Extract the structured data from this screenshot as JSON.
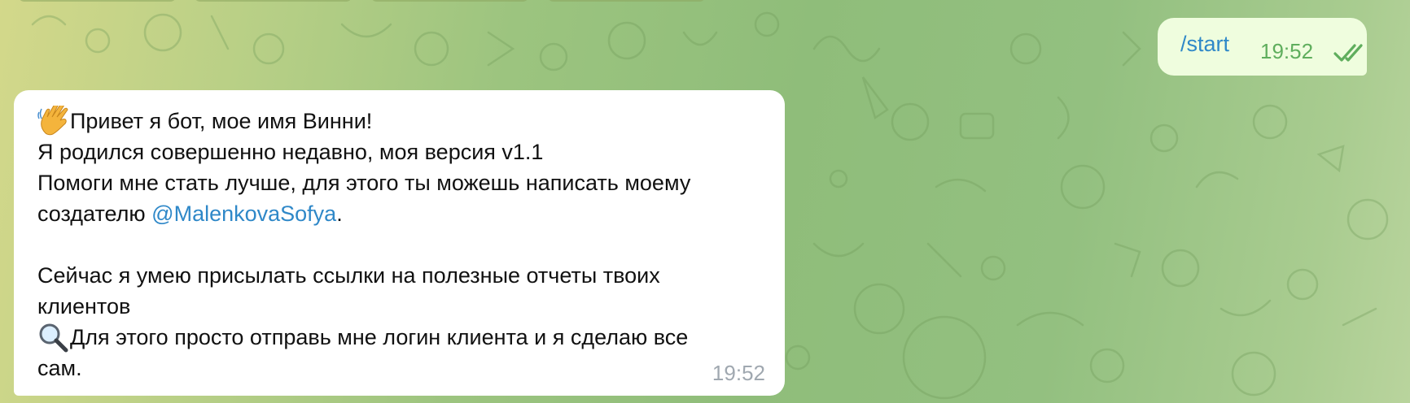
{
  "chat": {
    "outgoing": {
      "text": "/start",
      "time": "19:52",
      "status_icon": "double-check-icon"
    },
    "incoming": {
      "line1_emoji": "waving-hand-icon",
      "line1": "Привет я бот, мое имя Винни!",
      "line2": "Я родился совершенно недавно, моя версия v1.1",
      "line3": "Помоги мне стать лучше, для этого ты можешь написать моему",
      "line4_prefix": "создателю ",
      "mention": "@MalenkovaSofya",
      "line4_suffix": ".",
      "line5": "Сейчас я умею присылать ссылки на полезные отчеты твоих",
      "line6": "клиентов",
      "line7_emoji": "magnifier-icon",
      "line7": "Для этого просто отправь мне логин клиента и я сделаю все",
      "line8": "сам.",
      "time": "19:52"
    }
  },
  "colors": {
    "link": "#2f88c8",
    "outgoing_bubble": "#effdde",
    "outgoing_time": "#5fae5d",
    "incoming_bubble": "#ffffff"
  }
}
